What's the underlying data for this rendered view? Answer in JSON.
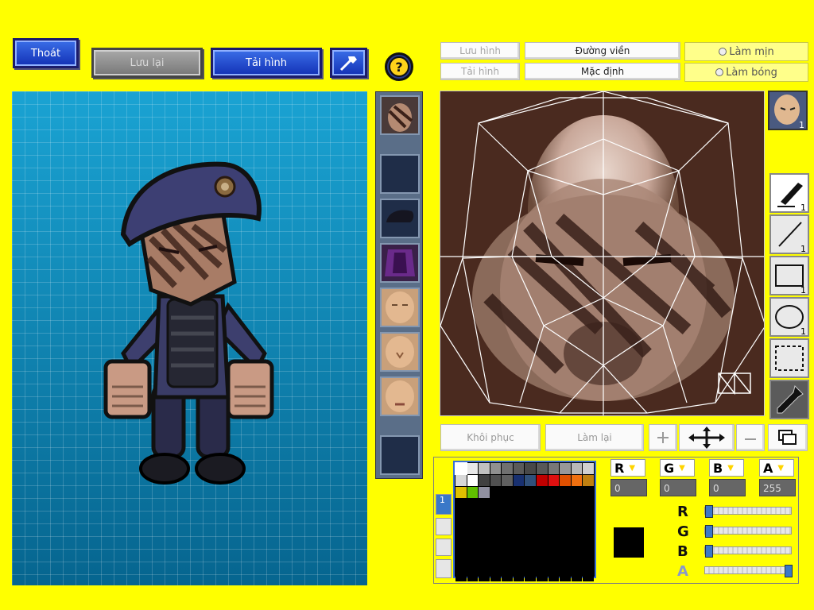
{
  "top_buttons": {
    "exit": "Thoát",
    "save": "Lưu lại",
    "reload": "Tải hình"
  },
  "icons": {
    "hammer": "hammer-icon",
    "help": "help-icon"
  },
  "editor_toolbar": {
    "save_image": "Lưu hình",
    "outline": "Đường viền",
    "smooth": "Làm mịn",
    "reload_image": "Tải hình",
    "default": "Mặc định",
    "shade": "Làm bóng"
  },
  "tools": [
    {
      "name": "pen-tool",
      "count": "1"
    },
    {
      "name": "line-tool",
      "count": "1"
    },
    {
      "name": "rect-tool",
      "count": "1"
    },
    {
      "name": "ellipse-tool",
      "count": "1"
    },
    {
      "name": "select-tool",
      "count": ""
    },
    {
      "name": "eyedropper-tool",
      "count": ""
    }
  ],
  "face_thumb_count": "1",
  "bottom_buttons": {
    "restore": "Khôi phục",
    "redo": "Làm lại"
  },
  "color": {
    "channels": [
      "R",
      "G",
      "B",
      "A"
    ],
    "values": {
      "R": "0",
      "G": "0",
      "B": "0",
      "A": "255"
    },
    "current": "#000000",
    "slider_levels": {
      "R": 0,
      "G": 0,
      "B": 0,
      "A": 1
    }
  },
  "palette": [
    "#ffffff",
    "#e8e8e8",
    "#c0c0c0",
    "#909090",
    "#707070",
    "#5a5a5a",
    "#484848",
    "#585858",
    "#787878",
    "#989898",
    "#b8b8b8",
    "#d0d0d0",
    "#d8d8d8",
    "#ffffff",
    "#404040",
    "#505050",
    "#606060",
    "#183070",
    "#30507a",
    "#c00000",
    "#e01010",
    "#e05000",
    "#f07010",
    "#c08010",
    "#e0c000",
    "#60c000",
    "#9090a0",
    "#000000",
    "#000000",
    "#000000",
    "#000000",
    "#000000",
    "#000000",
    "#000000",
    "#000000",
    "#000000"
  ],
  "palette_tab_number": "1",
  "accent_colors": {
    "background": "#ffff00",
    "preview": "#0a86b5",
    "button_blue": "#1230b5"
  }
}
